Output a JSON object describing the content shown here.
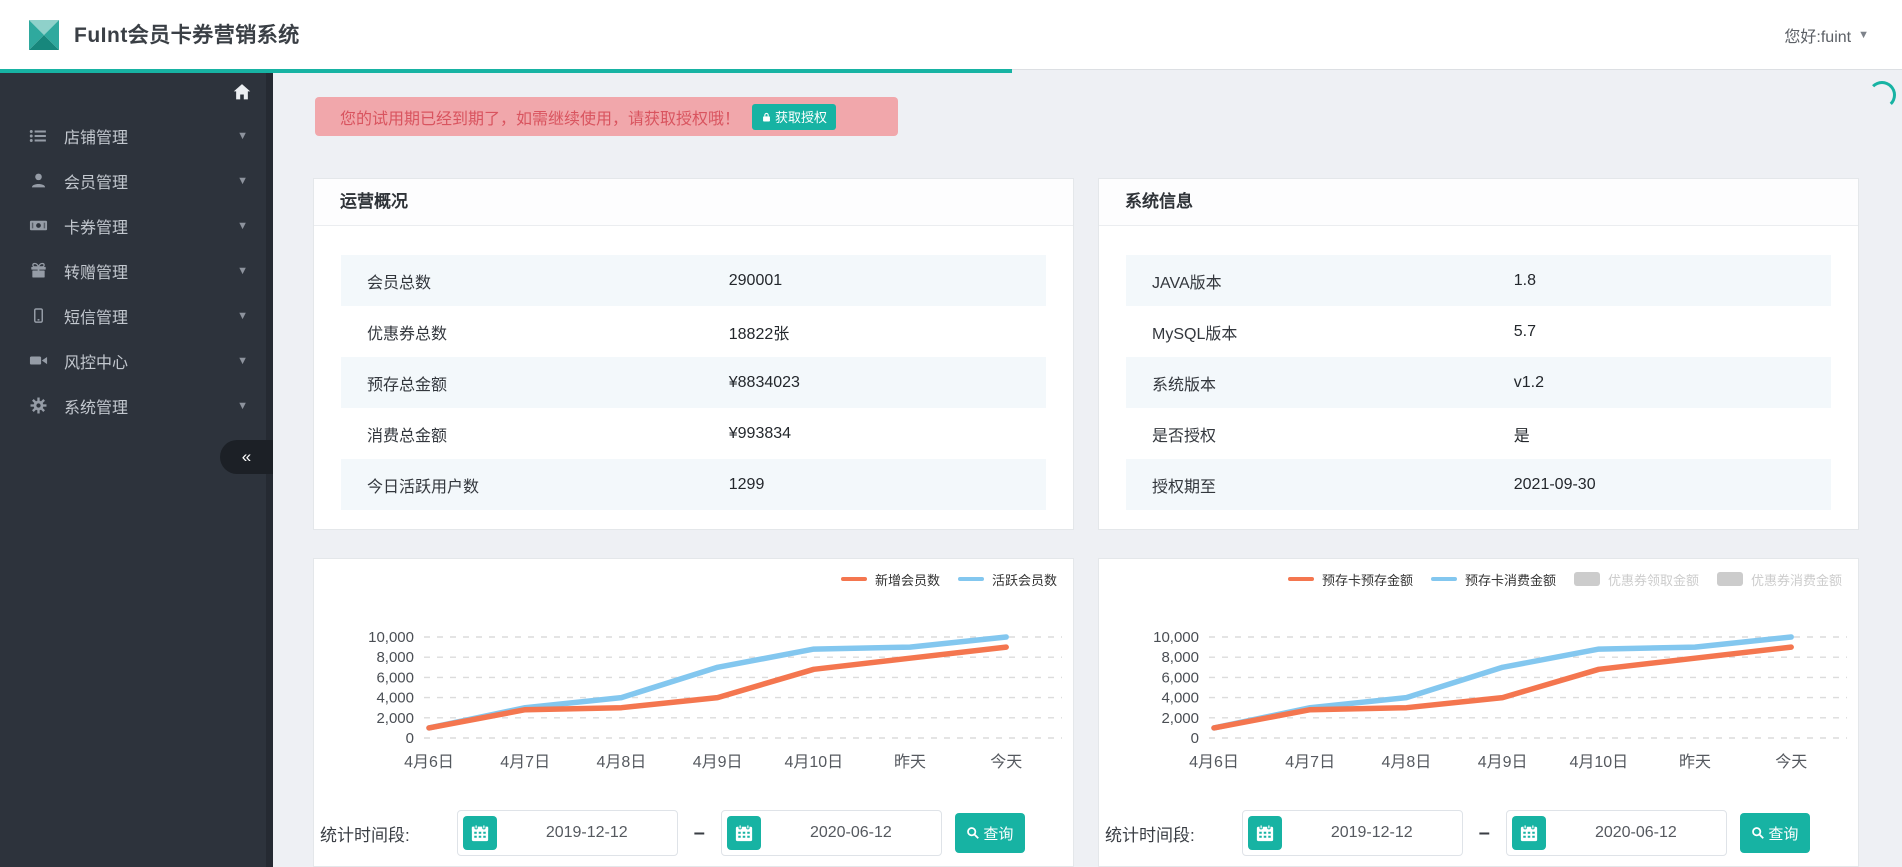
{
  "header": {
    "title": "FuInt会员卡券营销系统",
    "user": "您好:fuint"
  },
  "sidebar": {
    "items": [
      {
        "icon": "list-icon",
        "label": "店铺管理"
      },
      {
        "icon": "user-icon",
        "label": "会员管理"
      },
      {
        "icon": "money-icon",
        "label": "卡券管理"
      },
      {
        "icon": "gift-icon",
        "label": "转赠管理"
      },
      {
        "icon": "mobile-icon",
        "label": "短信管理"
      },
      {
        "icon": "video-icon",
        "label": "风控中心"
      },
      {
        "icon": "gear-icon",
        "label": "系统管理"
      }
    ],
    "collapse_glyph": "«"
  },
  "alert": {
    "text": "您的试用期已经到期了，如需继续使用，请获取授权哦！",
    "button": "获取授权"
  },
  "panels": [
    {
      "title": "运营概况",
      "rows": [
        {
          "label": "会员总数",
          "value": "290001"
        },
        {
          "label": "优惠券总数",
          "value": "18822张"
        },
        {
          "label": "预存总金额",
          "value": "¥8834023"
        },
        {
          "label": "消费总金额",
          "value": "¥993834"
        },
        {
          "label": "今日活跃用户数",
          "value": "1299"
        }
      ]
    },
    {
      "title": "系统信息",
      "rows": [
        {
          "label": "JAVA版本",
          "value": "1.8"
        },
        {
          "label": "MySQL版本",
          "value": "5.7"
        },
        {
          "label": "系统版本",
          "value": "v1.2"
        },
        {
          "label": "是否授权",
          "value": "是"
        },
        {
          "label": "授权期至",
          "value": "2021-09-30"
        }
      ]
    }
  ],
  "chart_data": [
    {
      "type": "line",
      "title": "",
      "categories": [
        "4月6日",
        "4月7日",
        "4月8日",
        "4月9日",
        "4月10日",
        "昨天",
        "今天"
      ],
      "series": [
        {
          "name": "新增会员数",
          "color": "#f4764f",
          "enabled": true,
          "values": [
            1000,
            2800,
            3000,
            4000,
            6800,
            7900,
            9000
          ]
        },
        {
          "name": "活跃会员数",
          "color": "#83c7ef",
          "enabled": true,
          "values": [
            1000,
            3000,
            4000,
            7000,
            8800,
            9000,
            10000
          ]
        }
      ],
      "ylim": [
        0,
        10000
      ],
      "yticks": [
        0,
        2000,
        4000,
        6000,
        8000,
        10000
      ],
      "ytick_labels": [
        "0",
        "2,000",
        "4,000",
        "6,000",
        "8,000",
        "10,000"
      ],
      "grid": "dashed",
      "legend_position": "top-right"
    },
    {
      "type": "line",
      "title": "",
      "categories": [
        "4月6日",
        "4月7日",
        "4月8日",
        "4月9日",
        "4月10日",
        "昨天",
        "今天"
      ],
      "series": [
        {
          "name": "预存卡预存金额",
          "color": "#f4764f",
          "enabled": true,
          "values": [
            1000,
            2800,
            3000,
            4000,
            6800,
            7900,
            9000
          ]
        },
        {
          "name": "预存卡消费金额",
          "color": "#83c7ef",
          "enabled": true,
          "values": [
            1000,
            3000,
            4000,
            7000,
            8800,
            9000,
            10000
          ]
        },
        {
          "name": "优惠券领取金额",
          "color": "#cccccc",
          "enabled": false,
          "values": []
        },
        {
          "name": "优惠券消费金额",
          "color": "#cccccc",
          "enabled": false,
          "values": []
        }
      ],
      "ylim": [
        0,
        10000
      ],
      "yticks": [
        0,
        2000,
        4000,
        6000,
        8000,
        10000
      ],
      "ytick_labels": [
        "0",
        "2,000",
        "4,000",
        "6,000",
        "8,000",
        "10,000"
      ],
      "grid": "dashed",
      "legend_position": "top-right"
    }
  ],
  "controls": {
    "label": "统计时间段:",
    "start_date": "2019-12-12",
    "separator": "–",
    "end_date": "2020-06-12",
    "search": "查询"
  },
  "colors": {
    "accent": "#17b3a3",
    "sidebar_bg": "#2d333c",
    "alert_bg": "#f1a7ab",
    "alert_text": "#d9545f",
    "series_orange": "#f4764f",
    "series_blue": "#83c7ef",
    "legend_disabled": "#cccccc",
    "row_alt_bg": "#f3f8fb"
  }
}
